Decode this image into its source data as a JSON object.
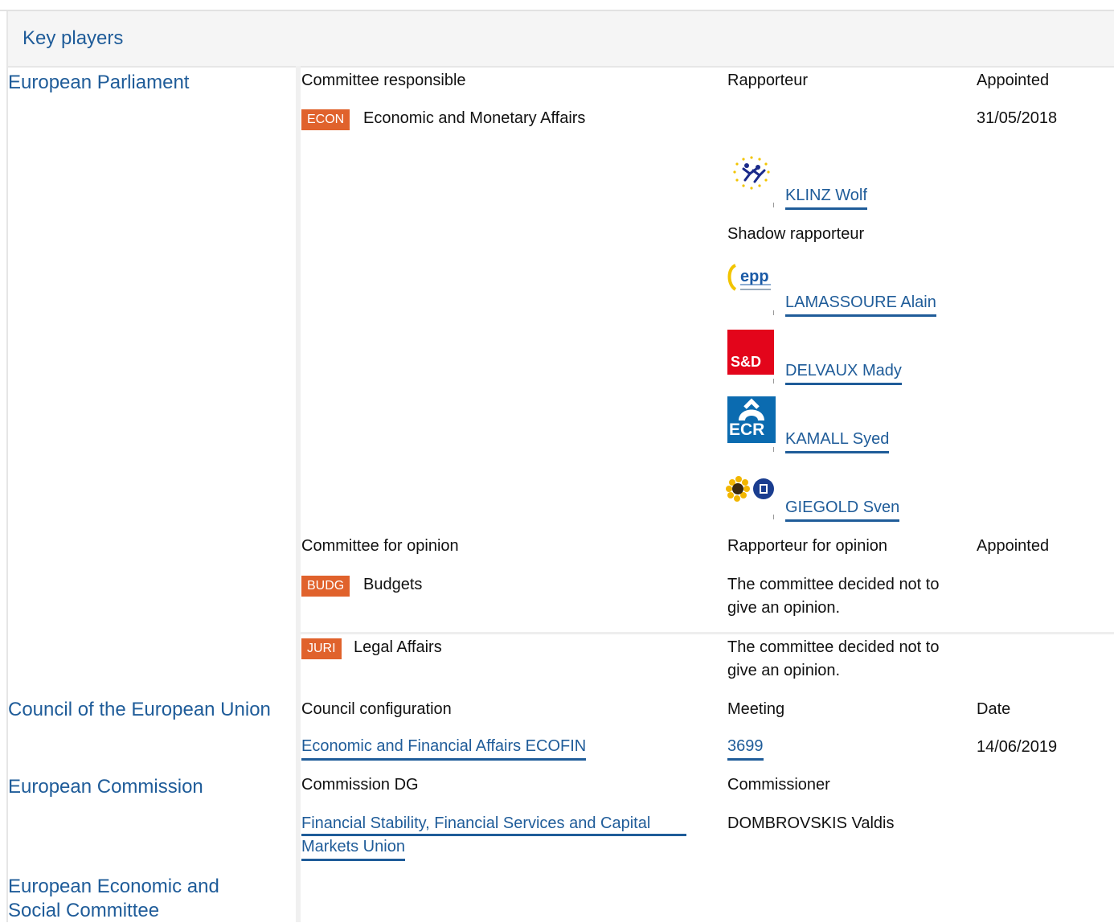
{
  "header": {
    "title": "Key players"
  },
  "european_parliament": {
    "institution": "European Parliament",
    "responsible": {
      "headers": {
        "committee": "Committee responsible",
        "rapporteur": "Rapporteur",
        "appointed": "Appointed"
      },
      "committee_code": "ECON",
      "committee_name": "Economic and Monetary Affairs",
      "appointed_date": "31/05/2018",
      "rapporteur": {
        "name": "KLINZ Wolf",
        "logo": "renew-europe-icon"
      },
      "shadow_label": "Shadow rapporteur",
      "shadow_rapporteurs": [
        {
          "name": "LAMASSOURE Alain",
          "logo": "epp-icon"
        },
        {
          "name": "DELVAUX Mady",
          "logo": "s-and-d-icon",
          "logo_text": "S&D"
        },
        {
          "name": "KAMALL Syed",
          "logo": "ecr-icon",
          "logo_text": "ECR"
        },
        {
          "name": "GIEGOLD Sven",
          "logo": "greens-efa-icon"
        }
      ]
    },
    "opinion": {
      "headers": {
        "committee": "Committee for opinion",
        "rapporteur": "Rapporteur for opinion",
        "appointed": "Appointed"
      },
      "rows": [
        {
          "code": "BUDG",
          "name": "Budgets",
          "decision_line1": "The committee decided not to",
          "decision_line2": "give an opinion."
        },
        {
          "code": "JURI",
          "name": "Legal Affairs",
          "decision_line1": "The committee decided not to",
          "decision_line2": "give an opinion."
        }
      ]
    }
  },
  "council": {
    "institution": "Council of the European Union",
    "headers": {
      "configuration": "Council configuration",
      "meeting": "Meeting",
      "date": "Date"
    },
    "configuration": "Economic and Financial Affairs ECOFIN",
    "meeting": "3699",
    "date": "14/06/2019"
  },
  "commission": {
    "institution": "European Commission",
    "headers": {
      "dg": "Commission DG",
      "commissioner": "Commissioner"
    },
    "dg_line1": "Financial Stability, Financial Services and Capital",
    "dg_line2": "Markets Union",
    "commissioner": "DOMBROVSKIS Valdis"
  },
  "eesc": {
    "institution_line1": "European Economic and",
    "institution_line2": "Social Committee"
  },
  "colors": {
    "link": "#1f5c99",
    "tag": "#e0622c",
    "sd_red": "#e3051b",
    "ecr_blue": "#0b6bb0"
  }
}
